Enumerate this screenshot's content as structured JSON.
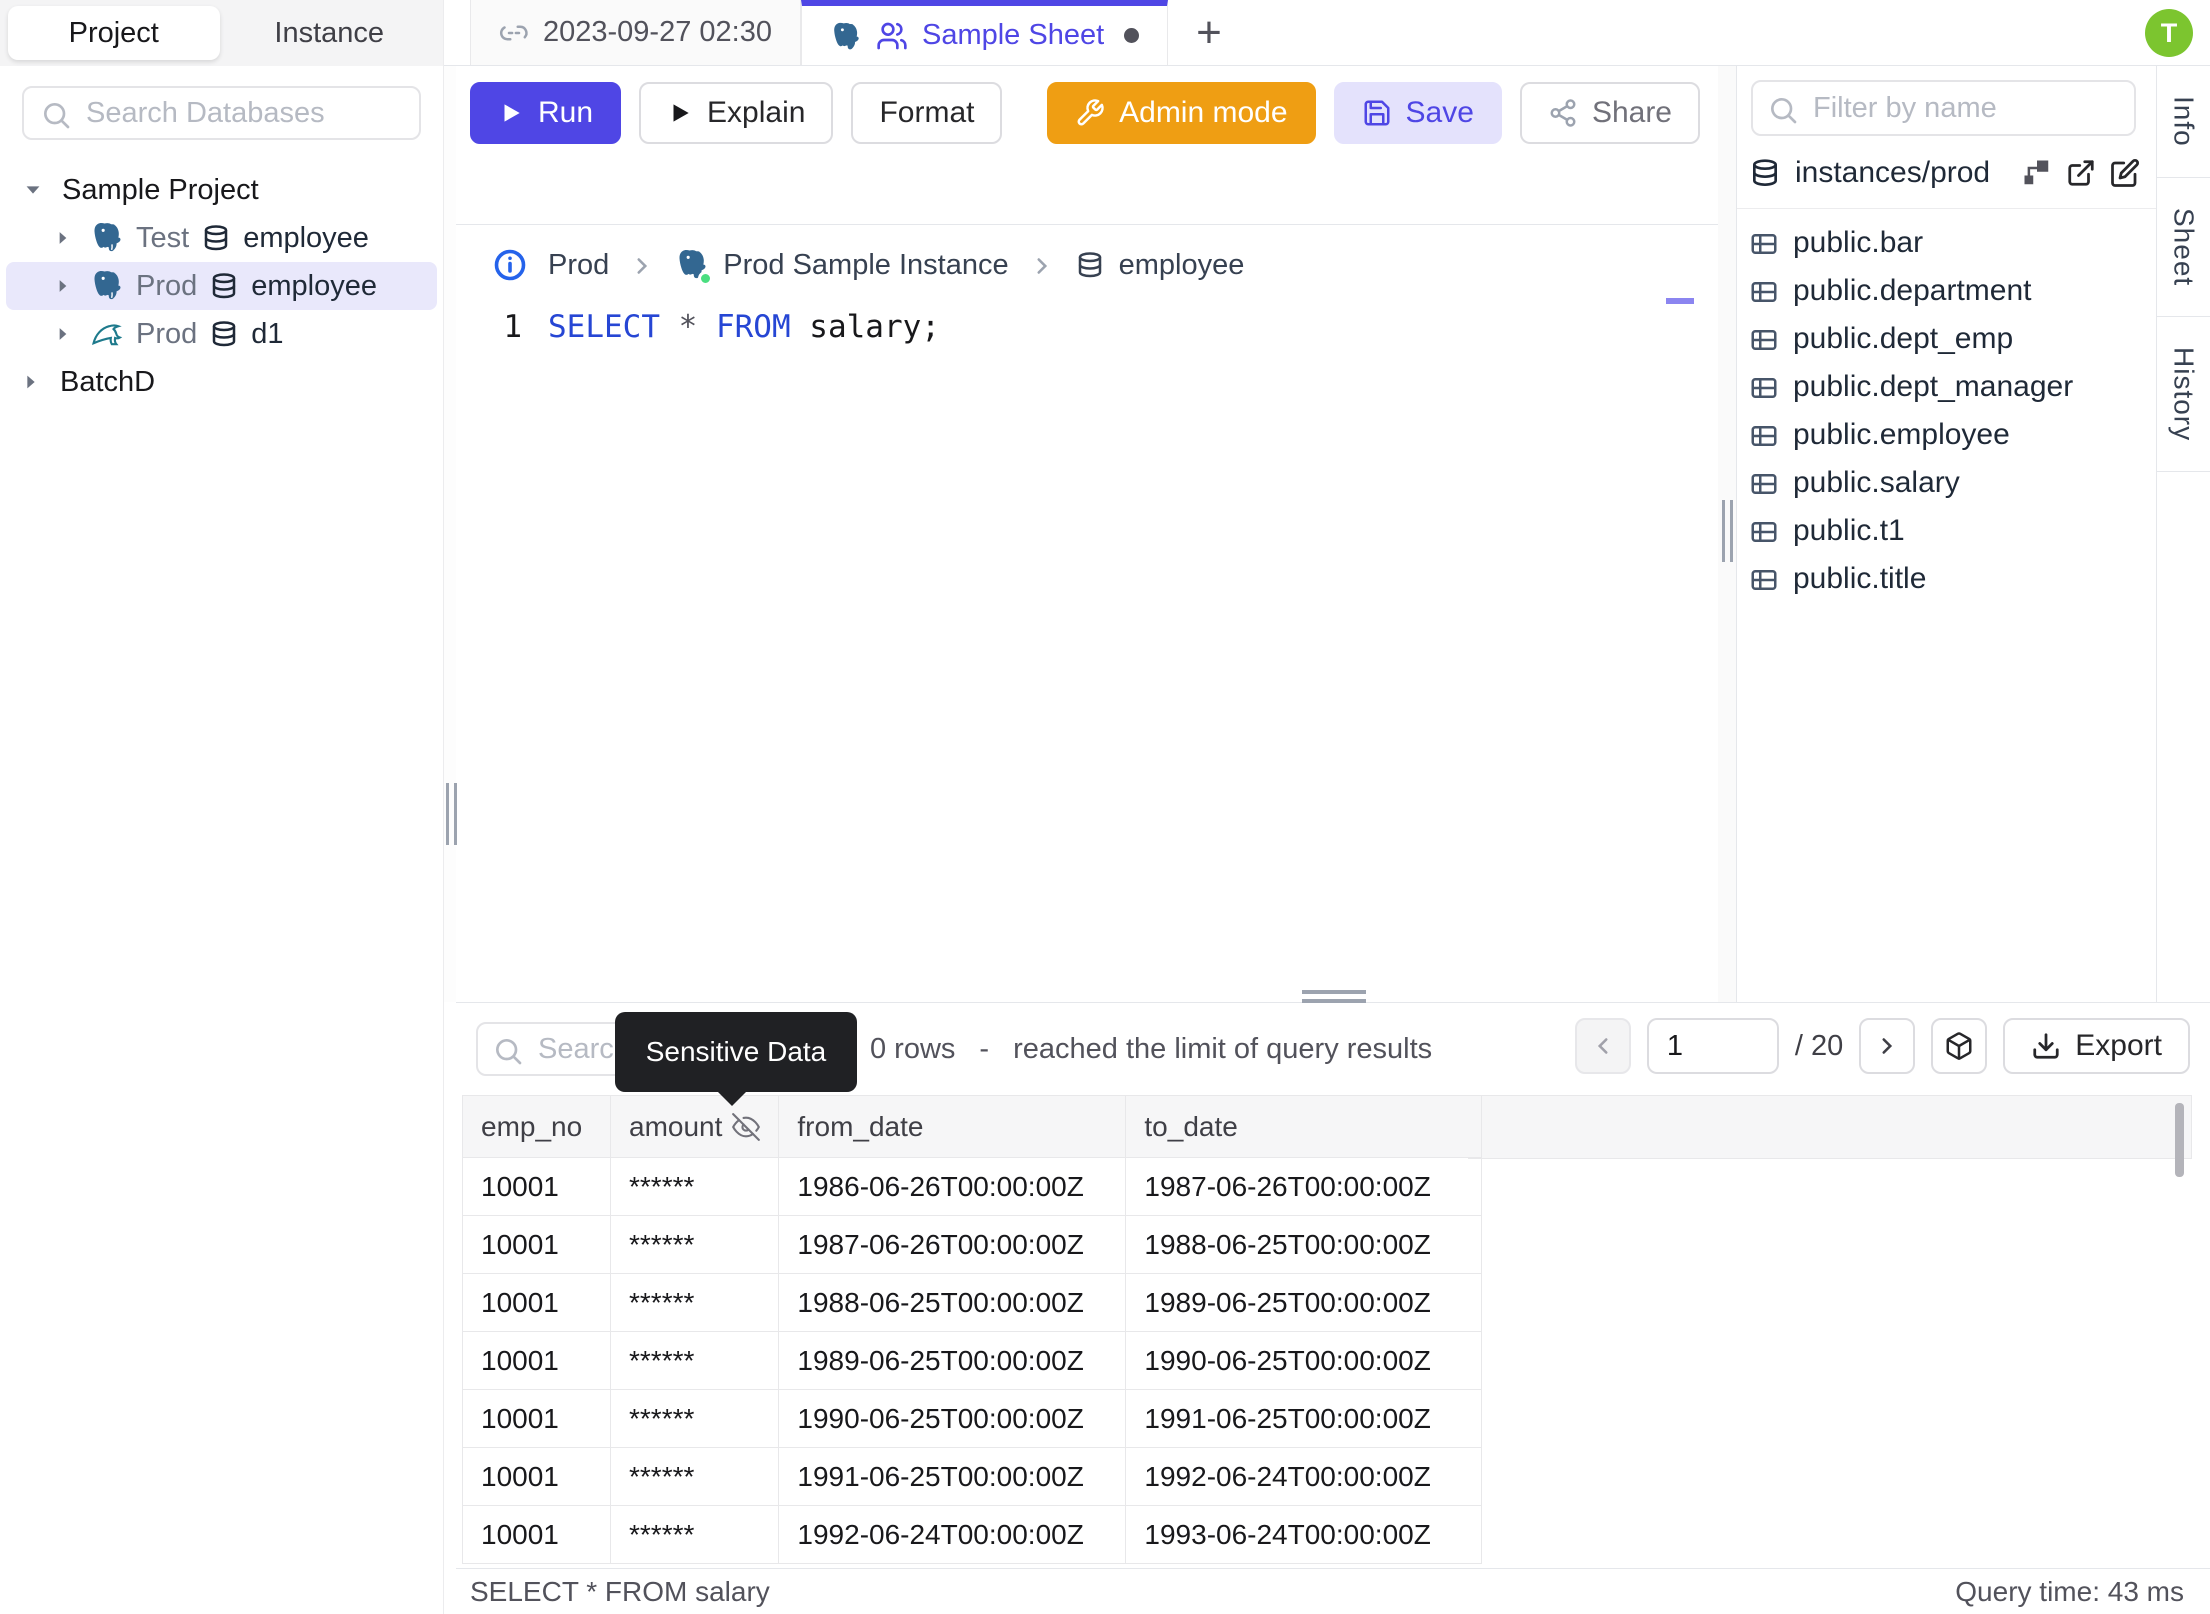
{
  "app": {
    "avatar_initial": "T"
  },
  "colors": {
    "accent_indigo": "#4f46e5",
    "admin_orange": "#ef9e13",
    "save_bg": "#e4e2fc",
    "avatar_green": "#7cc52f",
    "status_green": "#4ade80",
    "postgres_blue": "#336791",
    "mysql_teal": "#00758f",
    "keyword_blue": "#2646d4",
    "tooltip_bg": "#202124",
    "selected_row_bg": "#e9e8fb"
  },
  "sidebar": {
    "tabs": [
      {
        "label": "Project"
      },
      {
        "label": "Instance"
      }
    ],
    "search_placeholder": "Search Databases",
    "tree": {
      "root": "Sample Project",
      "items": [
        {
          "env": "Test",
          "db": "employee",
          "engine_icon": "postgres-icon",
          "db_icon": "database-icon"
        },
        {
          "env": "Prod",
          "db": "employee",
          "engine_icon": "postgres-icon",
          "db_icon": "database-icon"
        },
        {
          "env": "Prod",
          "db": "d1",
          "engine_icon": "mysql-icon",
          "db_icon": "database-icon"
        }
      ],
      "collapsed": "BatchD"
    }
  },
  "editor_tabs": {
    "tabs": [
      {
        "label": "2023-09-27 02:30",
        "icon": "unlink-icon"
      },
      {
        "label": "Sample Sheet",
        "icons": [
          "postgres-icon",
          "users-icon"
        ],
        "unsaved": true
      }
    ],
    "add_label": "+"
  },
  "toolbar": {
    "run_label": "Run",
    "explain_label": "Explain",
    "format_label": "Format",
    "admin_mode_label": "Admin mode",
    "save_label": "Save",
    "share_label": "Share"
  },
  "breadcrumb": {
    "items": [
      "Prod",
      "Prod Sample Instance",
      "employee"
    ]
  },
  "sql_editor": {
    "line_number": "1",
    "kw1": "SELECT",
    "star": " * ",
    "kw2": "FROM",
    "tail": " salary;"
  },
  "right_panel": {
    "filter_placeholder": "Filter by name",
    "instance_path": "instances/prod",
    "action_icons": [
      "hierarchy-icon",
      "external-link-icon",
      "edit-icon"
    ],
    "tables": [
      "public.bar",
      "public.department",
      "public.dept_emp",
      "public.dept_manager",
      "public.employee",
      "public.salary",
      "public.t1",
      "public.title"
    ]
  },
  "side_tabs": [
    "Info",
    "Sheet",
    "History"
  ],
  "results": {
    "search_placeholder": "Search",
    "tooltip": "Sensitive Data",
    "row_count_text": "0 rows",
    "dash": "-",
    "limit_text": "reached the limit of query results",
    "page_input": "1",
    "page_total": "/ 20",
    "export_label": "Export",
    "columns": [
      "emp_no",
      "amount",
      "from_date",
      "to_date"
    ],
    "masked_column_icon": "eye-off-icon",
    "rows": [
      [
        "10001",
        "******",
        "1986-06-26T00:00:00Z",
        "1987-06-26T00:00:00Z"
      ],
      [
        "10001",
        "******",
        "1987-06-26T00:00:00Z",
        "1988-06-25T00:00:00Z"
      ],
      [
        "10001",
        "******",
        "1988-06-25T00:00:00Z",
        "1989-06-25T00:00:00Z"
      ],
      [
        "10001",
        "******",
        "1989-06-25T00:00:00Z",
        "1990-06-25T00:00:00Z"
      ],
      [
        "10001",
        "******",
        "1990-06-25T00:00:00Z",
        "1991-06-25T00:00:00Z"
      ],
      [
        "10001",
        "******",
        "1991-06-25T00:00:00Z",
        "1992-06-24T00:00:00Z"
      ],
      [
        "10001",
        "******",
        "1992-06-24T00:00:00Z",
        "1993-06-24T00:00:00Z"
      ]
    ]
  },
  "status_bar": {
    "left": "SELECT * FROM salary",
    "right": "Query time: 43 ms"
  }
}
